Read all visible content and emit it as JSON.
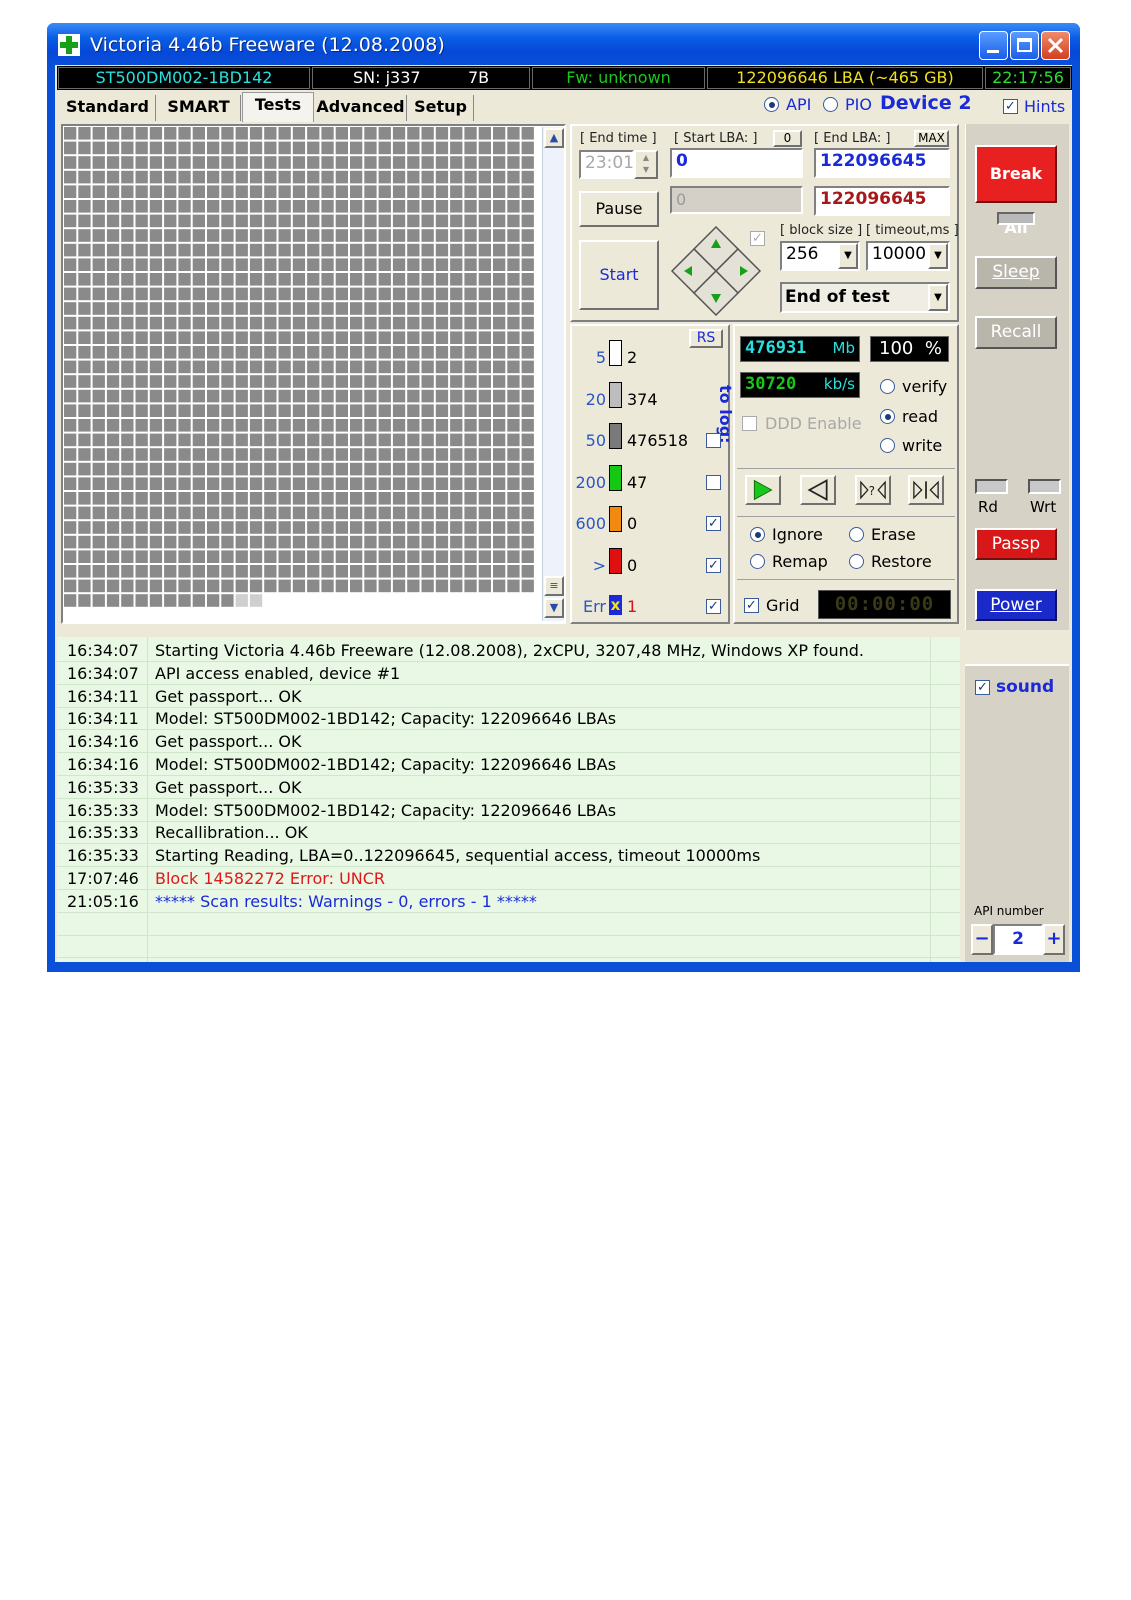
{
  "window": {
    "title": "Victoria 4.46b Freeware (12.08.2008)"
  },
  "status": {
    "model": "ST500DM002-1BD142",
    "serial": "SN: j337",
    "serial_code": "7B",
    "firmware": "Fw: unknown",
    "capacity": "122096646 LBA (~465 GB)",
    "clock": "22:17:56"
  },
  "tabs": [
    "Standard",
    "SMART",
    "Tests",
    "Advanced",
    "Setup"
  ],
  "active_tab": "Tests",
  "interface": {
    "api_label": "API",
    "pio_label": "PIO",
    "device": "Device 2",
    "hints_label": "Hints",
    "mode": "API"
  },
  "range": {
    "end_time_label": "[ End time ]",
    "end_time_value": "23:01",
    "start_lba_label": "[ Start LBA: ]",
    "start_lba_zero": "0",
    "start_lba_value": "0",
    "end_lba_label": "[ End LBA: ]",
    "end_lba_max": "MAX",
    "end_lba_value": "122096645",
    "current_lba": "0",
    "current_end": "122096645",
    "block_size_label": "[ block size ]",
    "block_size": "256",
    "timeout_label": "[ timeout,ms ]",
    "timeout": "10000",
    "end_action": "End of test"
  },
  "buttons": {
    "pause": "Pause",
    "start": "Start",
    "break_all": "Break All",
    "sleep": "Sleep",
    "recall": "Recall",
    "passp": "Passp",
    "power": "Power",
    "rs": "RS"
  },
  "legend": {
    "to_log": "to log:",
    "rows": [
      {
        "ms": "5",
        "count": "2",
        "color": "#ffffff",
        "log": false
      },
      {
        "ms": "20",
        "count": "374",
        "color": "#bdbdbd",
        "log": false
      },
      {
        "ms": "50",
        "count": "476518",
        "color": "#7a7a7a",
        "log": false
      },
      {
        "ms": "200",
        "count": "47",
        "color": "#16c816",
        "log": false
      },
      {
        "ms": "600",
        "count": "0",
        "color": "#f08a10",
        "log": true
      },
      {
        "ms": ">",
        "count": "0",
        "color": "#e01010",
        "log": true
      },
      {
        "ms": "Err",
        "count": "1",
        "color": "#1a2ad8",
        "log": true
      }
    ]
  },
  "stats": {
    "mb": "476931",
    "mb_unit": "Mb",
    "percent": "100",
    "percent_unit": "%",
    "speed": "30720",
    "speed_unit": "kb/s",
    "ddd_label": "DDD Enable",
    "modes": [
      "verify",
      "read",
      "write"
    ],
    "selected_mode": "read",
    "actions": [
      "Ignore",
      "Erase",
      "Remap",
      "Restore"
    ],
    "selected_action": "Ignore",
    "grid_label": "Grid",
    "timer": "00:00:00"
  },
  "side": {
    "rd_label": "Rd",
    "wrt_label": "Wrt",
    "sound_label": "sound",
    "api_number_label": "API number",
    "api_number": "2",
    "minus": "−",
    "plus": "+"
  },
  "log": [
    {
      "time": "16:34:07",
      "msg": "Starting Victoria 4.46b Freeware (12.08.2008), 2xCPU, 3207,48 MHz, Windows XP found.",
      "color": "#000000"
    },
    {
      "time": "16:34:07",
      "msg": "API access enabled, device #1",
      "color": "#000000"
    },
    {
      "time": "16:34:11",
      "msg": "Get passport... OK",
      "color": "#000000"
    },
    {
      "time": "16:34:11",
      "msg": "Model: ST500DM002-1BD142; Capacity: 122096646 LBAs",
      "color": "#000000"
    },
    {
      "time": "16:34:16",
      "msg": "Get passport... OK",
      "color": "#000000"
    },
    {
      "time": "16:34:16",
      "msg": "Model: ST500DM002-1BD142; Capacity: 122096646 LBAs",
      "color": "#000000"
    },
    {
      "time": "16:35:33",
      "msg": "Get passport... OK",
      "color": "#000000"
    },
    {
      "time": "16:35:33",
      "msg": "Model: ST500DM002-1BD142; Capacity: 122096646 LBAs",
      "color": "#000000"
    },
    {
      "time": "16:35:33",
      "msg": "Recallibration... OK",
      "color": "#000000"
    },
    {
      "time": "16:35:33",
      "msg": "Starting Reading, LBA=0..122096645, sequential access, timeout 10000ms",
      "color": "#000000"
    },
    {
      "time": "17:07:46",
      "msg": "Block 14582272 Error: UNCR",
      "color": "#e01818"
    },
    {
      "time": "21:05:16",
      "msg": "***** Scan results: Warnings - 0, errors - 1 *****",
      "color": "#1a2ad8"
    }
  ]
}
